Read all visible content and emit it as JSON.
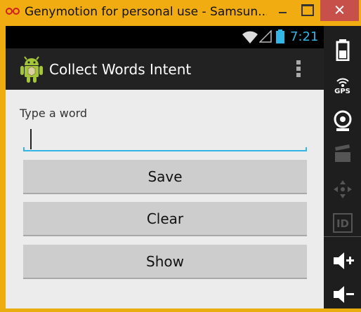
{
  "window": {
    "title": "Genymotion for personal use - Samsun..."
  },
  "status_bar": {
    "time": "7:21"
  },
  "action_bar": {
    "title": "Collect Words Intent"
  },
  "form": {
    "prompt_label": "Type a word",
    "input_value": "",
    "buttons": {
      "save": "Save",
      "clear": "Clear",
      "show": "Show"
    }
  },
  "sidebar": {
    "gps_label": "GPS",
    "id_label": "ID",
    "items": [
      "battery-icon",
      "gps-icon",
      "camera-icon",
      "video-icon",
      "dpad-icon",
      "id-icon",
      "volume-up-icon",
      "volume-down-icon"
    ]
  },
  "colors": {
    "accent": "#33b5e5",
    "title_bar": "#f0ac10",
    "close_button": "#c7504a"
  }
}
